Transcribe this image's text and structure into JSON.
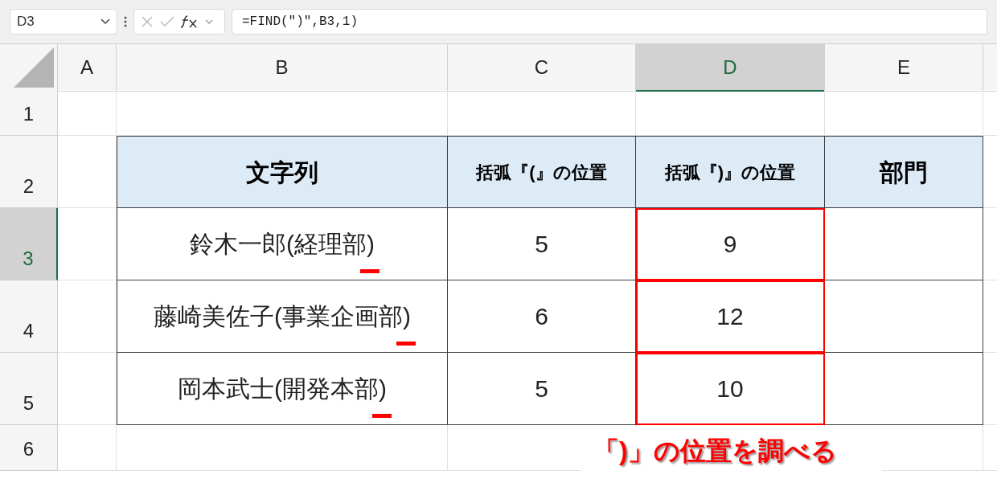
{
  "name_box": {
    "value": "D3"
  },
  "formula_bar": {
    "formula": "=FIND(\")\",B3,1)"
  },
  "columns": [
    {
      "label": "A",
      "selected": false
    },
    {
      "label": "B",
      "selected": false
    },
    {
      "label": "C",
      "selected": false
    },
    {
      "label": "D",
      "selected": true
    },
    {
      "label": "E",
      "selected": false
    }
  ],
  "rows": [
    {
      "label": "1",
      "selected": false
    },
    {
      "label": "2",
      "selected": false,
      "kind": "header",
      "cells": [
        {
          "text": "文字列"
        },
        {
          "text": "括弧『(』の位置"
        },
        {
          "text": "括弧『)』の位置"
        },
        {
          "text": "部門"
        }
      ]
    },
    {
      "label": "3",
      "selected": true,
      "kind": "data",
      "cells": [
        {
          "text": "鈴木一郎(経理部)",
          "marked": true
        },
        {
          "text": "5"
        },
        {
          "text": "9",
          "highlighted": true
        },
        {}
      ]
    },
    {
      "label": "4",
      "selected": false,
      "kind": "data",
      "cells": [
        {
          "text": "藤崎美佐子(事業企画部)",
          "marked": true
        },
        {
          "text": "6"
        },
        {
          "text": "12",
          "highlighted": true
        },
        {}
      ]
    },
    {
      "label": "5",
      "selected": false,
      "kind": "data",
      "cells": [
        {
          "text": "岡本武士(開発本部)",
          "marked": true
        },
        {
          "text": "5"
        },
        {
          "text": "10",
          "highlighted": true
        },
        {}
      ]
    },
    {
      "label": "6",
      "selected": false
    }
  ],
  "annotation": "「)」の位置を調べる"
}
